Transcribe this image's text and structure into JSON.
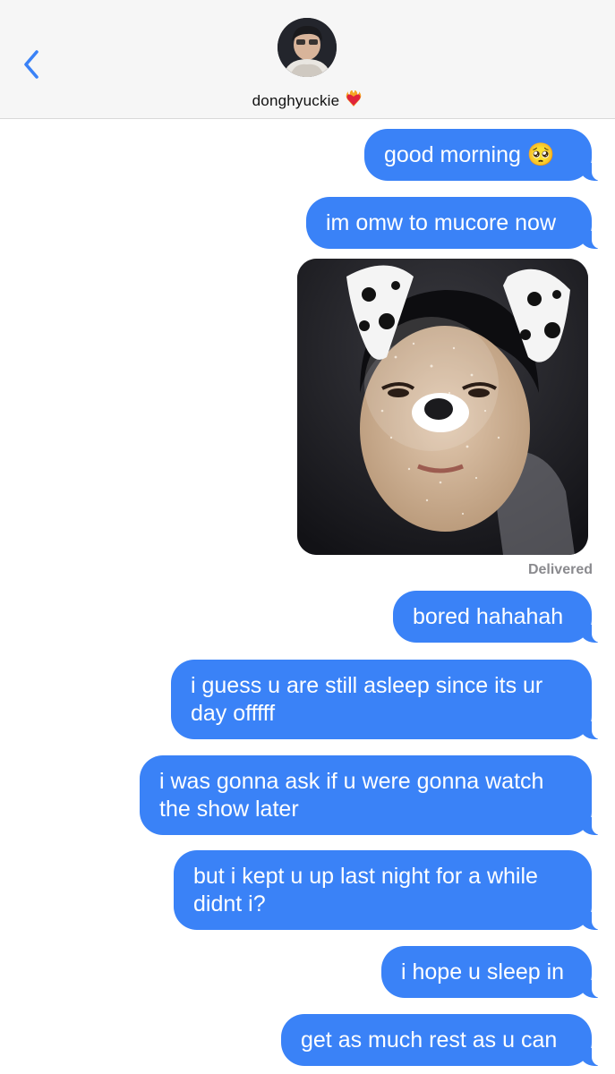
{
  "header": {
    "contact_name": "donghyuckie",
    "name_emoji_icon": "heart-on-fire-icon",
    "back_icon": "chevron-left-icon",
    "accent_color": "#3a82f7"
  },
  "messages": [
    {
      "text": "good morning 🥺",
      "from": "me"
    },
    {
      "text": "im omw to mucore now",
      "from": "me"
    },
    {
      "type": "image",
      "description_icon": "photo-attachment",
      "from": "me"
    },
    {
      "text": "bored hahahah",
      "from": "me"
    },
    {
      "text": "i guess u are still asleep since its ur day offfff",
      "from": "me"
    },
    {
      "text": "i was gonna ask if u were gonna watch the show later",
      "from": "me"
    },
    {
      "text": "but i kept u up last night for a while didnt i?",
      "from": "me"
    },
    {
      "text": "i hope u sleep in",
      "from": "me"
    },
    {
      "text": "get as much rest as u can",
      "from": "me"
    }
  ],
  "status": {
    "delivered_label": "Delivered"
  },
  "colors": {
    "bubble": "#3a82f7",
    "bubble_text": "#ffffff",
    "header_bg": "#f6f6f6",
    "status_text": "#8a8a8e"
  }
}
